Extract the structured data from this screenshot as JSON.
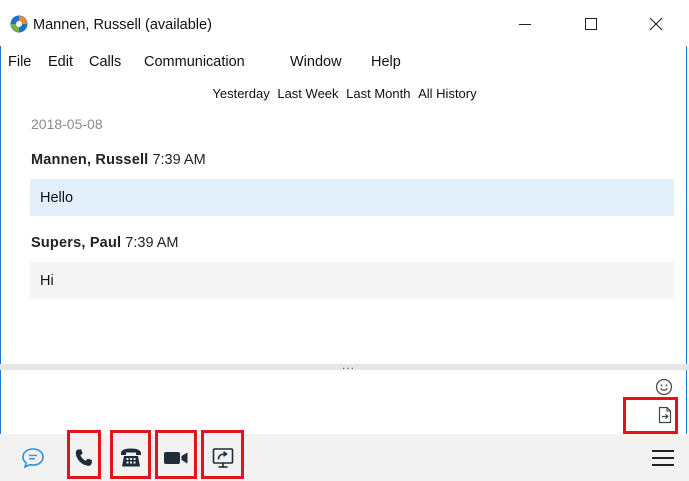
{
  "window": {
    "title": "Mannen, Russell (available)",
    "app_icon": "lync-app-icon",
    "controls": [
      "minimize-icon",
      "maximize-icon",
      "close-icon"
    ]
  },
  "menu": [
    "File",
    "Edit",
    "Calls",
    "Communication",
    "Window",
    "Help"
  ],
  "history_filters": [
    "Yesterday",
    "Last Week",
    "Last Month",
    "All History"
  ],
  "conversation": {
    "date": "2018-05-08",
    "messages": [
      {
        "sender": "Mannen, Russell",
        "time": "7:39 AM",
        "text": "Hello"
      },
      {
        "sender": "Supers, Paul",
        "time": "7:39 AM",
        "text": "Hi"
      }
    ]
  },
  "splitter_grip": "...",
  "compose": {
    "emoticon_icon": "smiley-icon",
    "file_icon": "send-file-icon"
  },
  "toolbar": {
    "chat_icon": "chat-bubble-icon",
    "call_icon": "phone-handset-icon",
    "dialpad_icon": "desk-phone-icon",
    "video_icon": "video-camera-icon",
    "share_icon": "screen-share-icon",
    "menu_icon": "hamburger-menu-icon"
  },
  "colors": {
    "highlight_box": "#e0141a",
    "accent": "#1e7ad6",
    "my_message_bg": "#e2eefa",
    "their_message_bg": "#f5f5f5",
    "chat_icon": "#2d8fe0"
  }
}
